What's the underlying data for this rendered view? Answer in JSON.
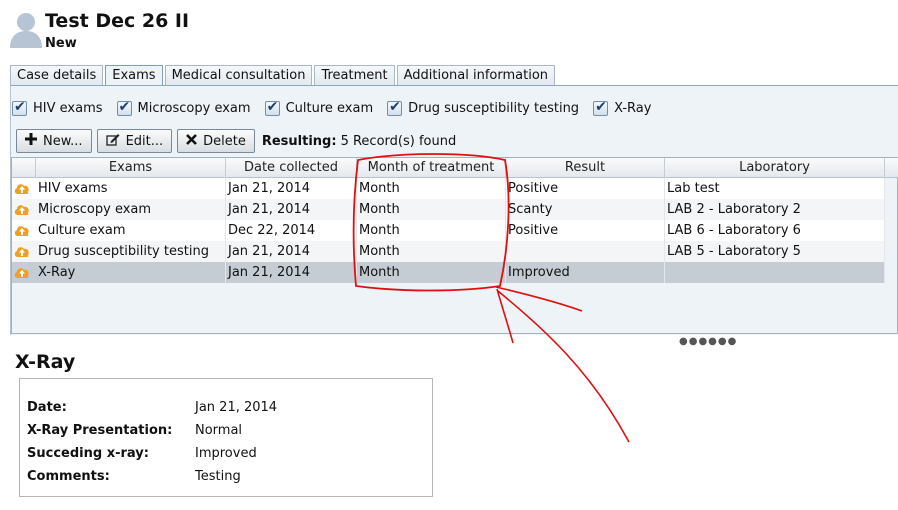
{
  "header": {
    "title": "Test Dec 26 II",
    "status": "New"
  },
  "tabs": [
    {
      "label": "Case details",
      "active": false
    },
    {
      "label": "Exams",
      "active": true
    },
    {
      "label": "Medical consultation",
      "active": false
    },
    {
      "label": "Treatment",
      "active": false
    },
    {
      "label": "Additional information",
      "active": false
    }
  ],
  "filters": [
    {
      "label": "HIV exams",
      "checked": true
    },
    {
      "label": "Microscopy exam",
      "checked": true
    },
    {
      "label": "Culture exam",
      "checked": true
    },
    {
      "label": "Drug susceptibility testing",
      "checked": true
    },
    {
      "label": "X-Ray",
      "checked": true
    }
  ],
  "toolbar": {
    "new_label": "New...",
    "edit_label": "Edit...",
    "delete_label": "Delete",
    "resulting_label": "Resulting:",
    "result_count": "5 Record(s) found"
  },
  "table": {
    "columns": [
      "Exams",
      "Date collected",
      "Month of treatment",
      "Result",
      "Laboratory"
    ],
    "rows": [
      {
        "exam": "HIV exams",
        "date": "Jan 21, 2014",
        "month": "Month",
        "result": "Positive",
        "laboratory": "Lab test"
      },
      {
        "exam": "Microscopy exam",
        "date": "Jan 21, 2014",
        "month": "Month",
        "result": "Scanty",
        "laboratory": "LAB 2 - Laboratory 2"
      },
      {
        "exam": "Culture exam",
        "date": "Dec 22, 2014",
        "month": "Month",
        "result": "Positive",
        "laboratory": "LAB 6 - Laboratory 6"
      },
      {
        "exam": "Drug susceptibility testing",
        "date": "Jan 21, 2014",
        "month": "Month",
        "result": "",
        "laboratory": "LAB 5 - Laboratory 5"
      },
      {
        "exam": "X-Ray",
        "date": "Jan 21, 2014",
        "month": "Month",
        "result": "Improved",
        "laboratory": ""
      }
    ]
  },
  "detail": {
    "title": "X-Ray",
    "fields": [
      {
        "label": "Date:",
        "value": "Jan 21, 2014"
      },
      {
        "label": "X-Ray Presentation:",
        "value": "Normal"
      },
      {
        "label": "Succeding x-ray:",
        "value": "Improved"
      },
      {
        "label": "Comments:",
        "value": "Testing"
      }
    ]
  },
  "icons": {
    "avatar": "user-avatar-icon",
    "row": "upload-arrow-icon",
    "new": "plus-icon",
    "edit": "edit-icon",
    "delete": "x-icon"
  },
  "colors": {
    "panel_bg": "#eef3f8",
    "selected_row": "#c5ccd4",
    "row_icon": "#f0a020",
    "annotation": "#e01010"
  }
}
